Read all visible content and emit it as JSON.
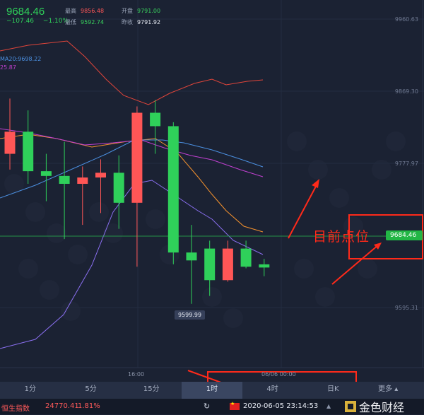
{
  "quote": {
    "price": "9684.46",
    "change": "−107.46",
    "change_pct": "−1.10%",
    "stats": [
      {
        "label": "最高",
        "value": "9856.48",
        "tone": "red"
      },
      {
        "label": "开盘",
        "value": "9791.00",
        "tone": "green"
      },
      {
        "label": "最低",
        "value": "9592.74",
        "tone": "green"
      },
      {
        "label": "昨收",
        "value": "9791.92",
        "tone": "white"
      }
    ]
  },
  "indicators": {
    "ma20_label": "MA20:9698.22",
    "ma_partial_label": "25.87"
  },
  "y_axis": {
    "ticks": [
      "9960.63",
      "9869.30",
      "9777.97",
      "9595.31"
    ]
  },
  "x_axis": {
    "ticks": [
      "16:00",
      "06/06 00:00"
    ]
  },
  "low_marker": "9599.99",
  "current_price_tag": "9684.46",
  "annotation": "目前点位",
  "timeframes": {
    "items": [
      "1分",
      "5分",
      "15分",
      "1时",
      "4时",
      "日K"
    ],
    "active": "1时",
    "more_label": "更多 ▴"
  },
  "ticker": {
    "index_name": "恒生指数",
    "index_value": "24770.41",
    "index_pct": "1.81%",
    "datetime": "2020-06-05 23:14:53",
    "brand": "金色财经"
  },
  "colors": {
    "bg": "#1b2233",
    "up": "#ff5656",
    "down": "#2fd05a",
    "annotation": "#ff2a1a",
    "ma_orange": "#f5922e",
    "ma_blue": "#4b8fe0",
    "ma_magenta": "#c040d0",
    "band_purple": "#8a6ff0",
    "band_red": "#e0453a"
  },
  "candles": [
    {
      "o": 9790,
      "c": 9818,
      "h": 9860,
      "l": 9770
    },
    {
      "o": 9818,
      "c": 9768,
      "h": 9845,
      "l": 9752
    },
    {
      "o": 9768,
      "c": 9762,
      "h": 9790,
      "l": 9730
    },
    {
      "o": 9762,
      "c": 9752,
      "h": 9805,
      "l": 9682
    },
    {
      "o": 9752,
      "c": 9760,
      "h": 9774,
      "l": 9700
    },
    {
      "o": 9760,
      "c": 9766,
      "h": 9783,
      "l": 9715
    },
    {
      "o": 9766,
      "c": 9728,
      "h": 9788,
      "l": 9695
    },
    {
      "o": 9728,
      "c": 9842,
      "h": 9850,
      "l": 9647
    },
    {
      "o": 9842,
      "c": 9825,
      "h": 9858,
      "l": 9790
    },
    {
      "o": 9825,
      "c": 9665,
      "h": 9830,
      "l": 9650
    },
    {
      "o": 9665,
      "c": 9655,
      "h": 9700,
      "l": 9600
    },
    {
      "o": 9670,
      "c": 9630,
      "h": 9680,
      "l": 9610
    },
    {
      "o": 9630,
      "c": 9670,
      "h": 9680,
      "l": 9628
    },
    {
      "o": 9670,
      "c": 9647,
      "h": 9680,
      "l": 9645
    },
    {
      "o": 9650,
      "c": 9646,
      "h": 9657,
      "l": 9635
    }
  ]
}
